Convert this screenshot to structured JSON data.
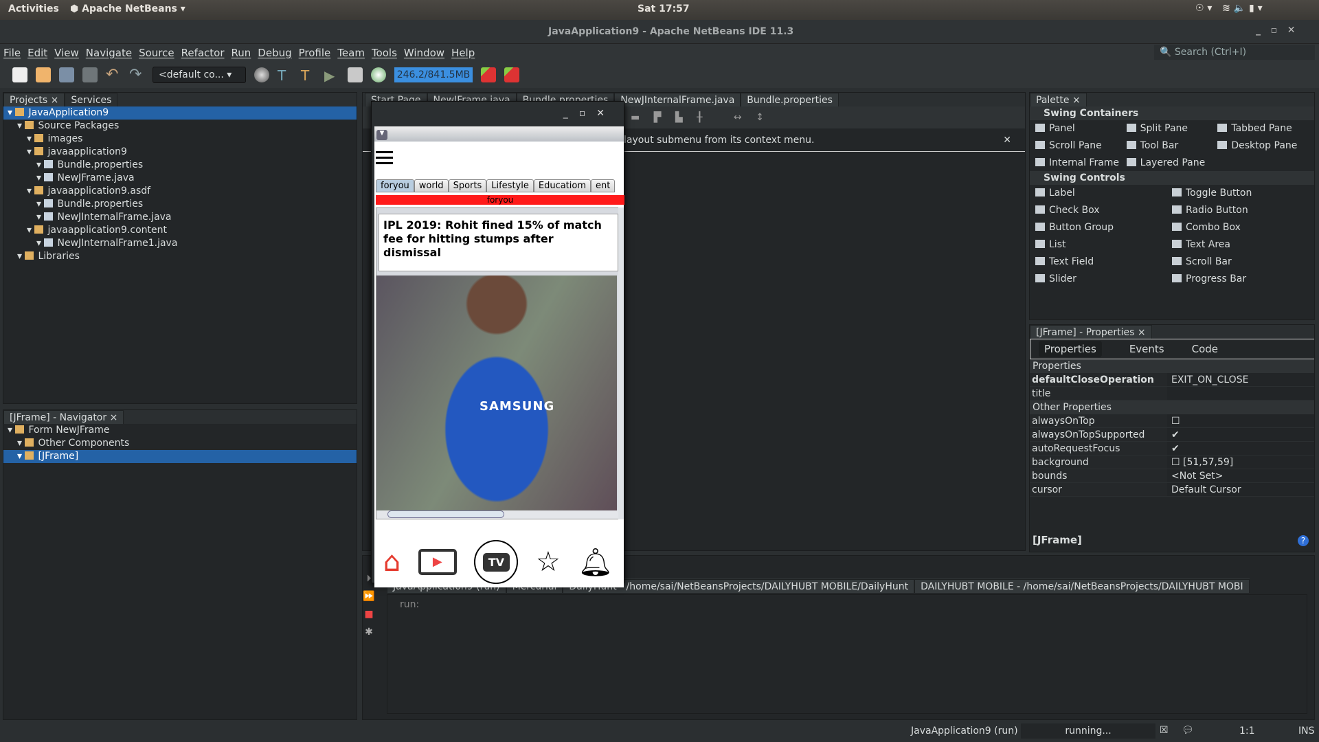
{
  "topbar": {
    "activities": "Activities",
    "app": "Apache NetBeans",
    "clock": "Sat 17:57"
  },
  "window": {
    "title": "JavaApplication9 - Apache NetBeans IDE 11.3"
  },
  "menu": [
    "File",
    "Edit",
    "View",
    "Navigate",
    "Source",
    "Refactor",
    "Run",
    "Debug",
    "Profile",
    "Team",
    "Tools",
    "Window",
    "Help"
  ],
  "search": {
    "placeholder": "Search (Ctrl+I)"
  },
  "toolbar": {
    "config": "<default co...",
    "memory": "246.2/841.5MB",
    "memory_fraction": 0.29
  },
  "projects": {
    "tabs": [
      "Projects",
      "Services"
    ],
    "tree": [
      {
        "label": "JavaApplication9",
        "depth": 0,
        "selected": true
      },
      {
        "label": "Source Packages",
        "depth": 1
      },
      {
        "label": "images",
        "depth": 2
      },
      {
        "label": "javaapplication9",
        "depth": 2
      },
      {
        "label": "Bundle.properties",
        "depth": 3
      },
      {
        "label": "NewJFrame.java",
        "depth": 3
      },
      {
        "label": "javaapplication9.asdf",
        "depth": 2
      },
      {
        "label": "Bundle.properties",
        "depth": 3
      },
      {
        "label": "NewJInternalFrame.java",
        "depth": 3
      },
      {
        "label": "javaapplication9.content",
        "depth": 2
      },
      {
        "label": "NewJInternalFrame1.java",
        "depth": 3
      },
      {
        "label": "Libraries",
        "depth": 1
      }
    ]
  },
  "navigator": {
    "title": "[JFrame] - Navigator",
    "tree": [
      {
        "label": "Form NewJFrame",
        "depth": 0
      },
      {
        "label": "Other Components",
        "depth": 1
      },
      {
        "label": "[JFrame]",
        "depth": 1,
        "selected": true
      }
    ]
  },
  "editor": {
    "tabs": [
      "Start Page",
      "NewJFrame.java",
      "Bundle.properties",
      "NewJInternalFrame.java",
      "Bundle.properties"
    ],
    "hint": "layout submenu from its context menu."
  },
  "mobile": {
    "categories": [
      "foryou",
      "world",
      "Sports",
      "Lifestyle",
      "Educatiom",
      "ent"
    ],
    "selected_banner": "foryou",
    "headline": "IPL 2019: Rohit fined 15% of match fee for hitting stumps after dismissal",
    "nav": [
      "home-icon",
      "video-icon",
      "tv-icon",
      "star-icon",
      "bell-icon"
    ],
    "tv_label": "TV",
    "accent": "#ff1a1a"
  },
  "output": {
    "tabs": [
      "JavaApplication9 (run)",
      "Mercurial",
      "DailyHunt - /home/sai/NetBeansProjects/DAILYHUBT MOBILE/DailyHunt",
      "DAILYHUBT MOBILE - /home/sai/NetBeansProjects/DAILYHUBT MOBI"
    ],
    "text": "run:"
  },
  "palette": {
    "title": "Palette",
    "sections": [
      {
        "name": "Swing Containers",
        "items": [
          "Panel",
          "Split Pane",
          "Tabbed Pane",
          "Scroll Pane",
          "Tool Bar",
          "Desktop Pane",
          "Internal Frame",
          "Layered Pane"
        ]
      },
      {
        "name": "Swing Controls",
        "items": [
          "Label",
          "Toggle Button",
          "Check Box",
          "Radio Button",
          "Button Group",
          "Combo Box",
          "List",
          "Text Area",
          "Text Field",
          "Scroll Bar",
          "Slider",
          "Progress Bar"
        ]
      }
    ]
  },
  "properties": {
    "title": "[JFrame] - Properties",
    "tabs": [
      "Properties",
      "Events",
      "Code"
    ],
    "groups": [
      "Properties",
      "Other Properties"
    ],
    "rows": [
      {
        "k": "defaultCloseOperation",
        "v": "EXIT_ON_CLOSE"
      },
      {
        "k": "title",
        "v": ""
      },
      {
        "k": "alwaysOnTop",
        "v": "☐"
      },
      {
        "k": "alwaysOnTopSupported",
        "v": "✔"
      },
      {
        "k": "autoRequestFocus",
        "v": "✔"
      },
      {
        "k": "background",
        "v": "☐ [51,57,59]"
      },
      {
        "k": "bounds",
        "v": "<Not Set>"
      },
      {
        "k": "cursor",
        "v": "Default Cursor"
      }
    ],
    "footer": "[JFrame]"
  },
  "status": {
    "process": "JavaApplication9 (run)",
    "state": "running...",
    "position": "1:1",
    "mode": "INS"
  }
}
